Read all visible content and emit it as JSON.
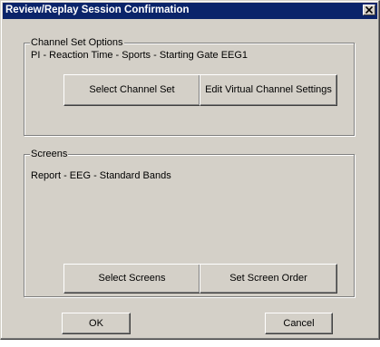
{
  "window": {
    "title": "Review/Replay Session Confirmation",
    "close_glyph": "close-icon"
  },
  "channel_set": {
    "legend": "Channel Set Options",
    "value": "PI - Reaction Time - Sports - Starting Gate EEG1",
    "select_label": "Select Channel Set",
    "edit_label": "Edit Virtual Channel Settings"
  },
  "screens": {
    "legend": "Screens",
    "value": "Report - EEG - Standard Bands",
    "select_label": "Select Screens",
    "order_label": "Set Screen Order"
  },
  "footer": {
    "ok_label": "OK",
    "cancel_label": "Cancel"
  }
}
